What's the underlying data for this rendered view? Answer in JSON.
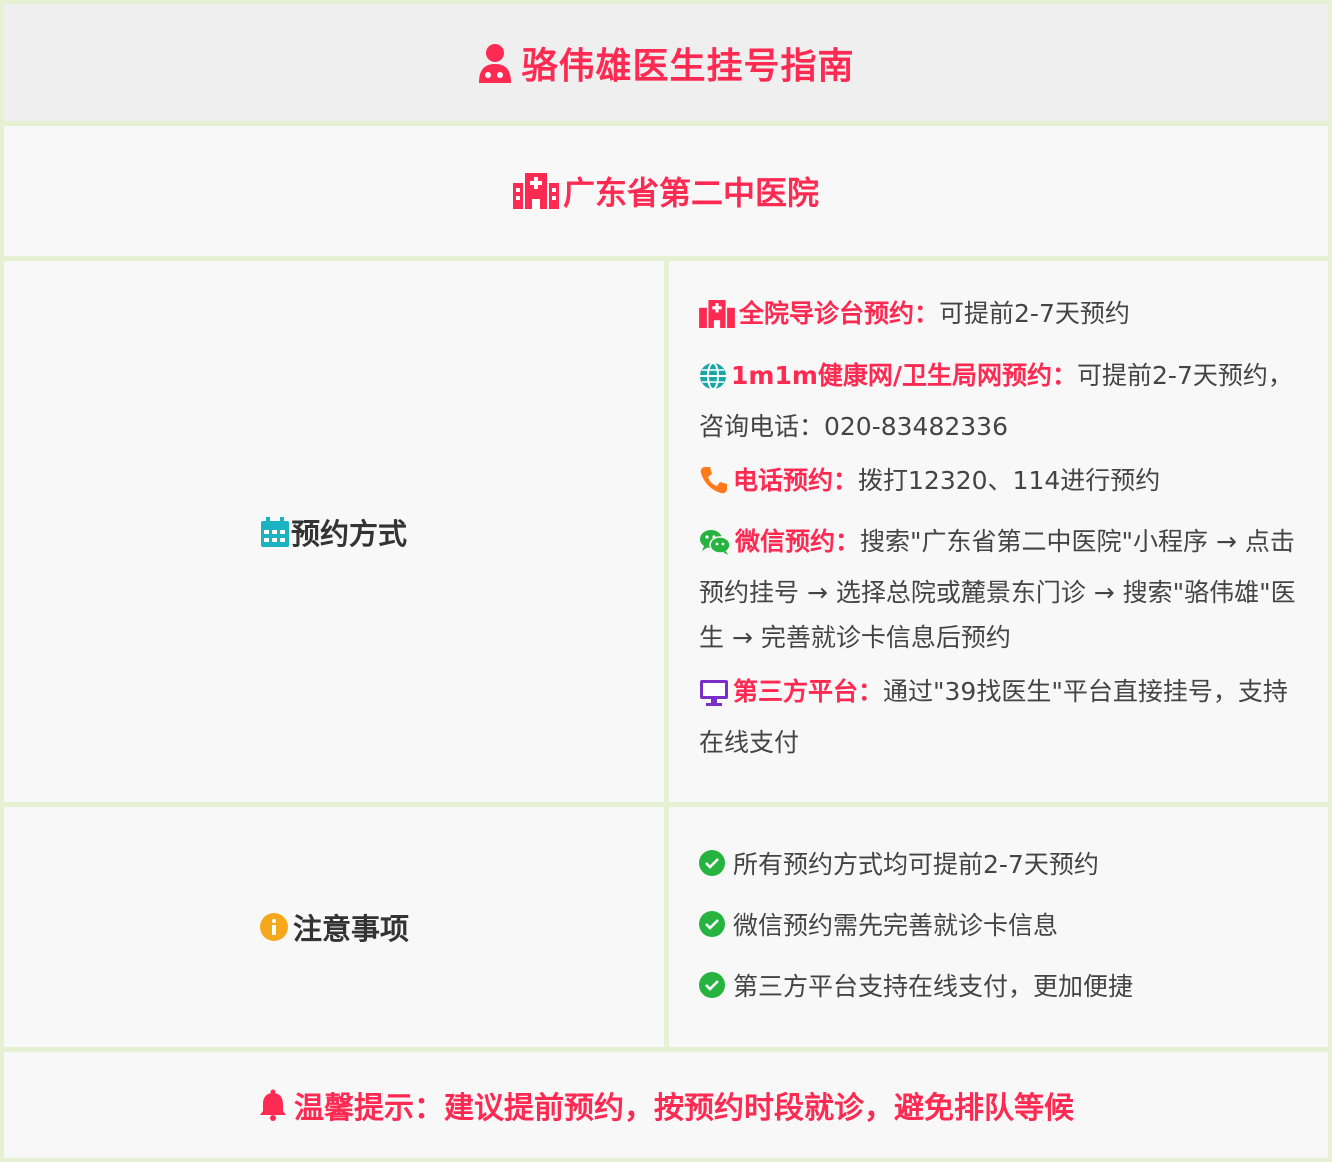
{
  "header": {
    "title": "骆伟雄医生挂号指南",
    "icon": "doctor-icon"
  },
  "hospital": {
    "name": "广东省第二中医院",
    "icon": "hospital-icon"
  },
  "booking": {
    "label": "预约方式",
    "icon": "calendar-icon",
    "methods": [
      {
        "icon": "hospital-icon",
        "icon_color": "#ff2a52",
        "key": "全院导诊台预约：",
        "text": "可提前2-7天预约"
      },
      {
        "icon": "globe-icon",
        "icon_color": "#1aa6a6",
        "key": "1m1m健康网/卫生局网预约：",
        "text": "可提前2-7天预约，咨询电话：020-83482336"
      },
      {
        "icon": "phone-icon",
        "icon_color": "#ff7a1a",
        "key": "电话预约：",
        "text": "拨打12320、114进行预约"
      },
      {
        "icon": "wechat-icon",
        "icon_color": "#26b33f",
        "key": "微信预约：",
        "text": "搜索\"广东省第二中医院\"小程序 → 点击预约挂号 → 选择总院或麓景东门诊 → 搜索\"骆伟雄\"医生 → 完善就诊卡信息后预约"
      },
      {
        "icon": "monitor-icon",
        "icon_color": "#7b2fc9",
        "key": "第三方平台：",
        "text": "通过\"39找医生\"平台直接挂号，支持在线支付"
      }
    ]
  },
  "notes": {
    "label": "注意事项",
    "icon": "info-icon",
    "items": [
      "所有预约方式均可提前2-7天预约",
      "微信预约需先完善就诊卡信息",
      "第三方平台支持在线支付，更加便捷"
    ]
  },
  "footer": {
    "text": "温馨提示：建议提前预约，按预约时段就诊，避免排队等候",
    "icon": "bell-icon"
  },
  "colors": {
    "accent": "#ff2a52",
    "border": "#e6f0d2",
    "check": "#26b33f"
  }
}
